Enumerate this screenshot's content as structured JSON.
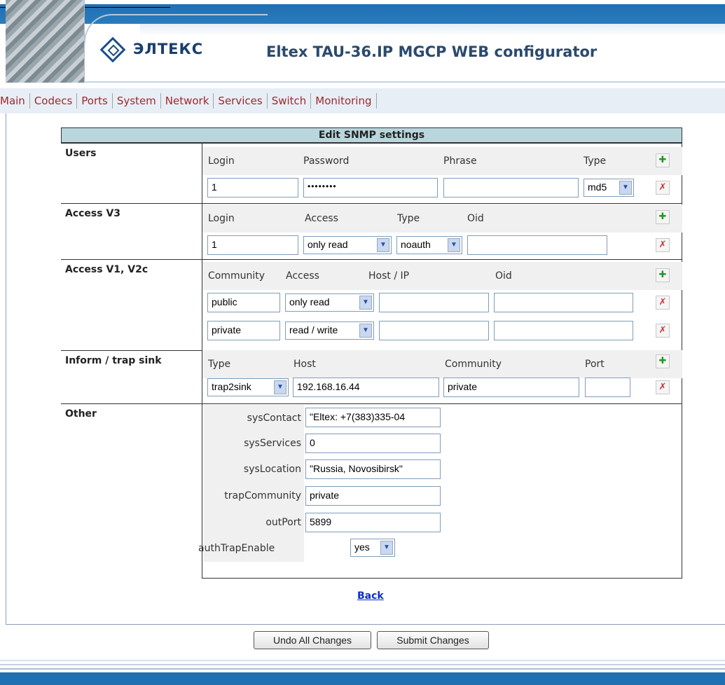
{
  "header": {
    "logo_text": "ЭЛТЕКС",
    "title": "Eltex TAU-36.IP MGCP WEB configurator"
  },
  "nav": [
    "Main",
    "Codecs",
    "Ports",
    "System",
    "Network",
    "Services",
    "Switch",
    "Monitoring"
  ],
  "panel": {
    "title": "Edit SNMP settings",
    "users": {
      "label": "Users",
      "headers": [
        "Login",
        "Password",
        "Phrase",
        "Type"
      ],
      "row": {
        "login": "1",
        "password": "••••••••",
        "phrase": "",
        "type": "md5"
      }
    },
    "access_v3": {
      "label": "Access V3",
      "headers": [
        "Login",
        "Access",
        "Type",
        "Oid"
      ],
      "row": {
        "login": "1",
        "access": "only read",
        "type": "noauth",
        "oid": ""
      }
    },
    "access_v1": {
      "label": "Access V1, V2c",
      "headers": [
        "Community",
        "Access",
        "Host / IP",
        "Oid"
      ],
      "rows": [
        {
          "community": "public",
          "access": "only read",
          "host": "",
          "oid": ""
        },
        {
          "community": "private",
          "access": "read / write",
          "host": "",
          "oid": ""
        }
      ]
    },
    "trap": {
      "label": "Inform / trap sink",
      "headers": [
        "Type",
        "Host",
        "Community",
        "Port"
      ],
      "row": {
        "type": "trap2sink",
        "host": "192.168.16.44",
        "community": "private",
        "port": ""
      }
    },
    "other": {
      "label": "Other",
      "fields": [
        {
          "label": "sysContact",
          "value": "\"Eltex: +7(383)335-04"
        },
        {
          "label": "sysServices",
          "value": "0"
        },
        {
          "label": "sysLocation",
          "value": "\"Russia, Novosibirsk\""
        },
        {
          "label": "trapCommunity",
          "value": "private"
        },
        {
          "label": "outPort",
          "value": "5899"
        }
      ],
      "auth_label": "authTrapEnable",
      "auth_value": "yes"
    },
    "back_link": "Back"
  },
  "buttons": {
    "undo": "Undo All Changes",
    "submit": "Submit Changes"
  },
  "icons": {
    "add": "add-icon",
    "delete": "delete-icon",
    "dropdown": "chevron-down-icon"
  }
}
